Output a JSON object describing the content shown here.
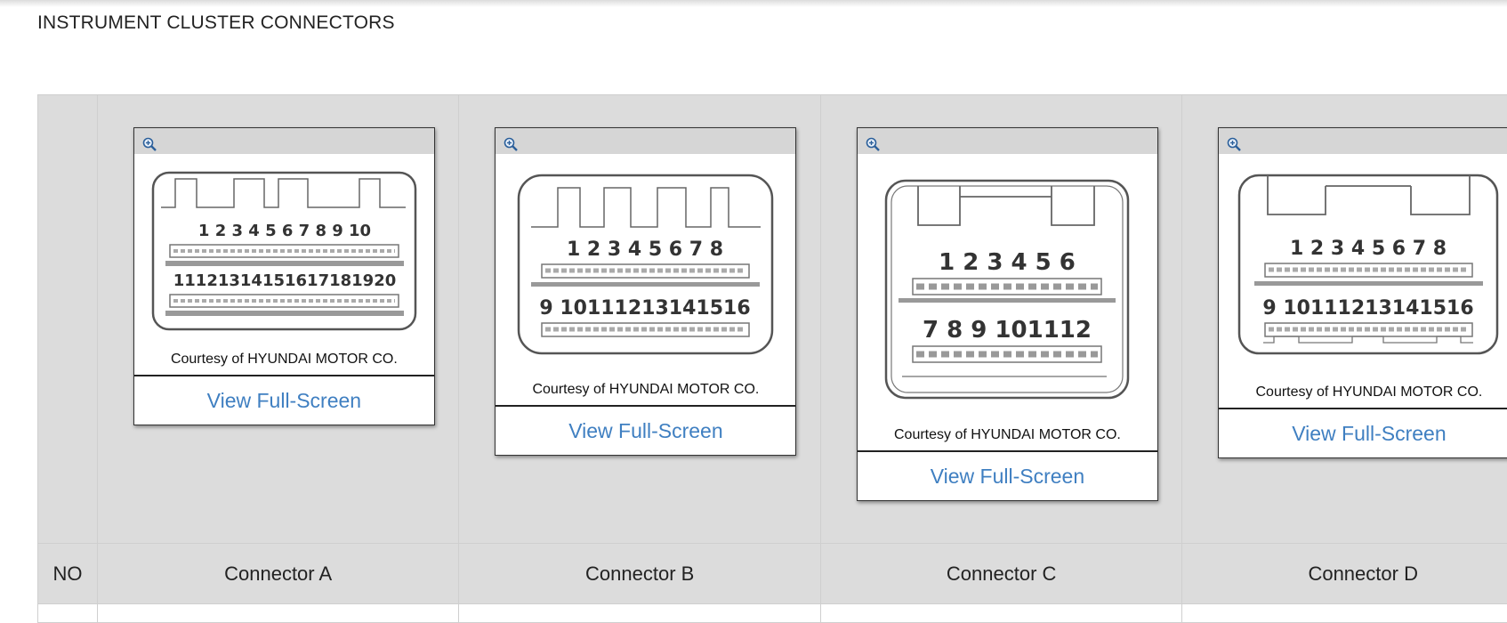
{
  "page_title": "INSTRUMENT CLUSTER CONNECTORS",
  "table": {
    "no_header": "NO",
    "connectors": [
      {
        "name": "Connector A",
        "courtesy": "Courtesy of HYUNDAI MOTOR CO.",
        "view_label": "View Full-Screen",
        "pin_row_1": "1 2 3 4 5 6 7 8 9 10",
        "pin_row_2": "11121314151617181920"
      },
      {
        "name": "Connector B",
        "courtesy": "Courtesy of HYUNDAI MOTOR CO.",
        "view_label": "View Full-Screen",
        "pin_row_1": "1 2 3 4 5 6 7 8",
        "pin_row_2": "9 10111213141516"
      },
      {
        "name": "Connector C",
        "courtesy": "Courtesy of HYUNDAI MOTOR CO.",
        "view_label": "View Full-Screen",
        "pin_row_1": "1 2 3 4 5 6",
        "pin_row_2": "7 8 9 101112"
      },
      {
        "name": "Connector D",
        "courtesy": "Courtesy of HYUNDAI MOTOR CO.",
        "view_label": "View Full-Screen",
        "pin_row_1": "1 2 3 4 5 6 7 8",
        "pin_row_2": "9 10111213141516"
      }
    ]
  },
  "icons": {
    "zoom": "zoom-in-magnifier-icon"
  },
  "colors": {
    "link": "#3f7fc1",
    "table_bg": "#dcdcdc",
    "card_header": "#d6d6d6"
  }
}
